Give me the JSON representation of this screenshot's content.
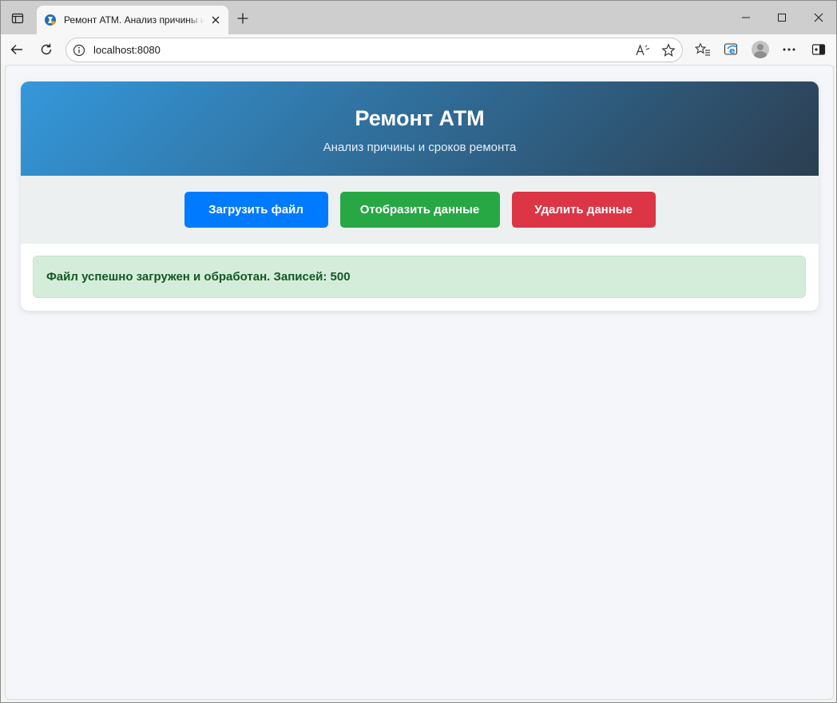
{
  "browser": {
    "tab_title": "Ремонт АТМ. Анализ причины и сроков ремонта",
    "url": "localhost:8080",
    "icons": {
      "tab_actions": "tab-actions-icon",
      "favicon": "favicon-icon",
      "tab_close": "close-icon",
      "new_tab": "plus-icon",
      "minimize": "minimize-icon",
      "maximize": "maximize-icon",
      "close_window": "close-icon",
      "back": "back-arrow-icon",
      "refresh": "refresh-icon",
      "site_info": "info-icon",
      "read_aloud": "read-aloud-icon",
      "favorite": "star-icon",
      "favorites": "favorites-icon",
      "ie_mode": "ie-mode-icon",
      "profile": "avatar",
      "more": "more-icon",
      "sidebar": "sidebar-icon"
    }
  },
  "page": {
    "header": {
      "title": "Ремонт АТМ",
      "subtitle": "Анализ причины и сроков ремонта"
    },
    "controls": {
      "upload_label": "Загрузить файл",
      "show_label": "Отобразить данные",
      "delete_label": "Удалить данные"
    },
    "status": {
      "message": "Файл успешно загружен и обработан. Записей: 500"
    }
  },
  "colors": {
    "header_gradient_start": "#3498db",
    "header_gradient_end": "#2c3e50",
    "upload_button": "#007bff",
    "show_button": "#28a745",
    "delete_button": "#dc3545",
    "status_background": "#d4edda",
    "status_text": "#155724"
  }
}
